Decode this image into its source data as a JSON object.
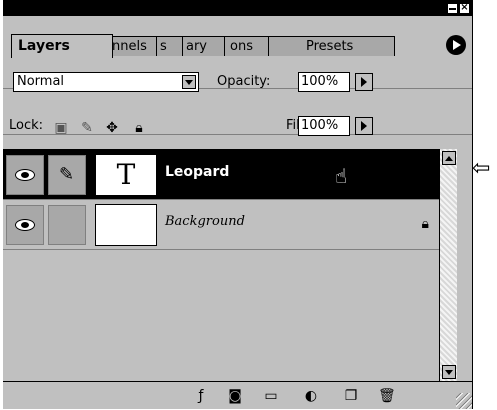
{
  "tabs": [
    {
      "label": "Layers"
    },
    {
      "label": "nnels"
    },
    {
      "label": "s"
    },
    {
      "label": "ary"
    },
    {
      "label": "ons"
    },
    {
      "label": "Presets"
    }
  ],
  "blend_mode": {
    "value": "Normal"
  },
  "opacity": {
    "label": "Opacity:",
    "value": "100%"
  },
  "lock": {
    "label": "Lock:"
  },
  "fill": {
    "label": "Fill:",
    "value": "100%"
  },
  "layers": [
    {
      "name": "Leopard",
      "thumb_text": "T",
      "selected": true
    },
    {
      "name": "Background",
      "selected": false,
      "locked": true
    }
  ],
  "colors": {
    "selection": "#000000",
    "panel": "#c0c0c0"
  }
}
